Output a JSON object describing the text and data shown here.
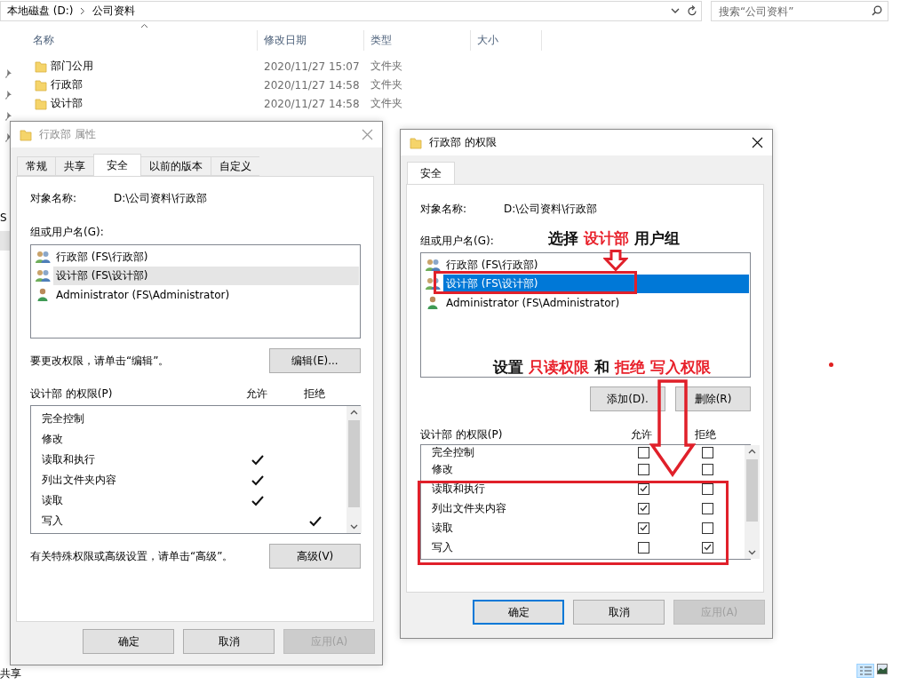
{
  "address_bar": {
    "path": [
      "本地磁盘 (D:)",
      "公司资料"
    ]
  },
  "search": {
    "placeholder": "搜索“公司资料”"
  },
  "file_list": {
    "columns": [
      "名称",
      "修改日期",
      "类型",
      "大小"
    ],
    "rows": [
      {
        "name": "部门公用",
        "modified": "2020/11/27 15:07",
        "type": "文件夹"
      },
      {
        "name": "行政部",
        "modified": "2020/11/27 14:58",
        "type": "文件夹"
      },
      {
        "name": "设计部",
        "modified": "2020/11/27 14:58",
        "type": "文件夹"
      }
    ]
  },
  "nav_pane": {
    "items": [
      {
        "label": "S"
      }
    ]
  },
  "status_bar": {
    "text": "共享"
  },
  "properties_dialog": {
    "title": "行政部 属性",
    "active": false,
    "tabs": [
      {
        "label": "常规",
        "selected": false
      },
      {
        "label": "共享",
        "selected": false
      },
      {
        "label": "安全",
        "selected": true
      },
      {
        "label": "以前的版本",
        "selected": false
      },
      {
        "label": "自定义",
        "selected": false
      }
    ],
    "object_label": "对象名称:",
    "object_value": "D:\\公司资料\\行政部",
    "groups_label": "组或用户名(G):",
    "groups": [
      {
        "name": "行政部 (FS\\行政部)",
        "kind": "group",
        "selected": false
      },
      {
        "name": "设计部 (FS\\设计部)",
        "kind": "group",
        "selected": true
      },
      {
        "name": "Administrator (FS\\Administrator)",
        "kind": "user",
        "selected": false
      }
    ],
    "edit_hint": "要更改权限，请单击“编辑”。",
    "edit_button": "编辑(E)...",
    "permissions_label": "设计部 的权限(P)",
    "allow_header": "允许",
    "deny_header": "拒绝",
    "permissions": [
      {
        "name": "完全控制",
        "allow": false,
        "deny": false
      },
      {
        "name": "修改",
        "allow": false,
        "deny": false
      },
      {
        "name": "读取和执行",
        "allow": true,
        "deny": false
      },
      {
        "name": "列出文件夹内容",
        "allow": true,
        "deny": false
      },
      {
        "name": "读取",
        "allow": true,
        "deny": false
      },
      {
        "name": "写入",
        "allow": false,
        "deny": true
      }
    ],
    "advanced_hint": "有关特殊权限或高级设置，请单击“高级”。",
    "advanced_button": "高级(V)",
    "buttons": [
      {
        "label": "确定",
        "disabled": false
      },
      {
        "label": "取消",
        "disabled": false
      },
      {
        "label": "应用(A)",
        "disabled": true
      }
    ]
  },
  "permissions_dialog": {
    "title": "行政部 的权限",
    "active": true,
    "tabs": [
      {
        "label": "安全",
        "selected": true
      }
    ],
    "object_label": "对象名称:",
    "object_value": "D:\\公司资料\\行政部",
    "groups_label": "组或用户名(G):",
    "groups": [
      {
        "name": "行政部 (FS\\行政部)",
        "kind": "group",
        "selected": false
      },
      {
        "name": "设计部 (FS\\设计部)",
        "kind": "group",
        "selected": true
      },
      {
        "name": "Administrator (FS\\Administrator)",
        "kind": "user",
        "selected": false
      }
    ],
    "add_button": "添加(D).",
    "remove_button": "删除(R)",
    "permissions_label": "设计部 的权限(P)",
    "allow_header": "允许",
    "deny_header": "拒绝",
    "permissions": [
      {
        "name": "完全控制",
        "allow": false,
        "deny": false
      },
      {
        "name": "修改",
        "allow": false,
        "deny": false
      },
      {
        "name": "读取和执行",
        "allow": true,
        "deny": false
      },
      {
        "name": "列出文件夹内容",
        "allow": true,
        "deny": false
      },
      {
        "name": "读取",
        "allow": true,
        "deny": false
      },
      {
        "name": "写入",
        "allow": false,
        "deny": true
      }
    ],
    "buttons": [
      {
        "label": "确定",
        "disabled": false,
        "default": true
      },
      {
        "label": "取消",
        "disabled": false,
        "default": false
      },
      {
        "label": "应用(A)",
        "disabled": true,
        "default": false
      }
    ]
  },
  "annotations": [
    {
      "parts": [
        {
          "text": "选择",
          "highlight": false
        },
        {
          "text": "设计部",
          "highlight": true
        },
        {
          "text": "用户组",
          "highlight": false
        }
      ]
    },
    {
      "parts": [
        {
          "text": "设置",
          "highlight": false
        },
        {
          "text": "只读权限",
          "highlight": true
        },
        {
          "text": "和",
          "highlight": false
        },
        {
          "text": "拒绝",
          "highlight": true
        },
        {
          "text": "写入权限",
          "highlight": true
        }
      ]
    }
  ]
}
